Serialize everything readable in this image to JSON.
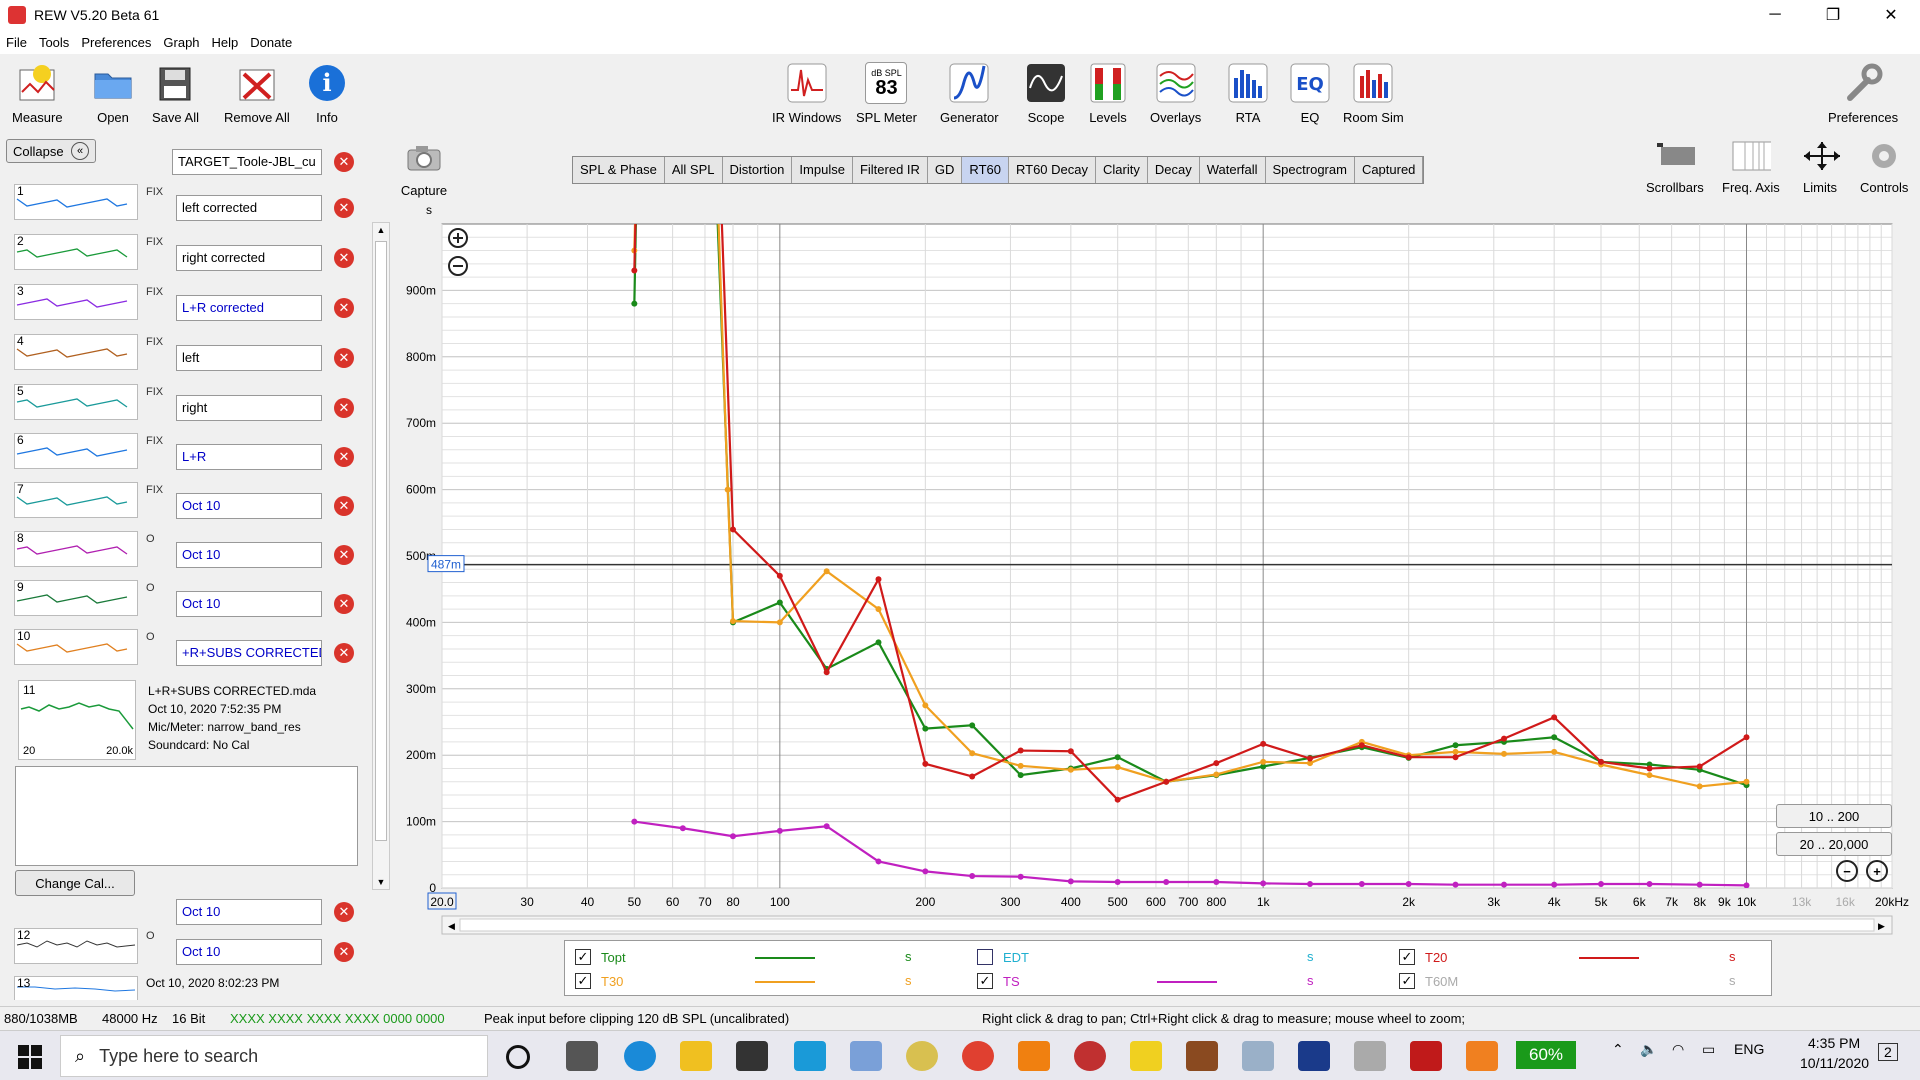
{
  "window": {
    "title": "REW V5.20 Beta 61",
    "minimize": "─",
    "restore": "❐",
    "close": "✕"
  },
  "menu": [
    "File",
    "Tools",
    "Preferences",
    "Graph",
    "Help",
    "Donate"
  ],
  "toolbar": {
    "left": [
      {
        "label": "Measure",
        "icon": "microphone-icon"
      },
      {
        "label": "Open",
        "icon": "folder-icon"
      },
      {
        "label": "Save All",
        "icon": "floppy-icon"
      },
      {
        "label": "Remove All",
        "icon": "remove-all-icon"
      },
      {
        "label": "Info",
        "icon": "info-icon"
      }
    ],
    "center": [
      {
        "label": "IR Windows",
        "icon": "ir-windows-icon"
      },
      {
        "label": "SPL Meter",
        "icon": "spl-meter-icon",
        "meter_unit": "dB SPL",
        "meter_value": "83"
      },
      {
        "label": "Generator",
        "icon": "generator-icon"
      },
      {
        "label": "Scope",
        "icon": "scope-icon"
      },
      {
        "label": "Levels",
        "icon": "levels-icon"
      },
      {
        "label": "Overlays",
        "icon": "overlays-icon"
      },
      {
        "label": "RTA",
        "icon": "rta-icon"
      },
      {
        "label": "EQ",
        "icon": "eq-icon"
      },
      {
        "label": "Room Sim",
        "icon": "room-sim-icon"
      }
    ],
    "preferences": "Preferences"
  },
  "left_panel": {
    "collapse_label": "Collapse",
    "target_name": "TARGET_Toole-JBL_cu",
    "measurements": [
      {
        "num": "1",
        "flag": "FIX",
        "name": "left corrected",
        "blue": false,
        "color": "#1f77e0"
      },
      {
        "num": "2",
        "flag": "FIX",
        "name": "right corrected",
        "blue": false,
        "color": "#1a9a3a"
      },
      {
        "num": "3",
        "flag": "FIX",
        "name": "L+R corrected",
        "blue": true,
        "color": "#8a2be2"
      },
      {
        "num": "4",
        "flag": "FIX",
        "name": "left",
        "blue": false,
        "color": "#b06020"
      },
      {
        "num": "5",
        "flag": "FIX",
        "name": "right",
        "blue": false,
        "color": "#1a9a9a"
      },
      {
        "num": "6",
        "flag": "FIX",
        "name": "L+R",
        "blue": true,
        "color": "#1f77e0"
      },
      {
        "num": "7",
        "flag": "FIX",
        "name": "Oct 10",
        "blue": true,
        "color": "#1a9a9a"
      },
      {
        "num": "8",
        "flag": "O",
        "name": "Oct 10",
        "blue": true,
        "color": "#b020b0"
      },
      {
        "num": "9",
        "flag": "O",
        "name": "Oct 10",
        "blue": true,
        "color": "#1a7a3a"
      },
      {
        "num": "10",
        "flag": "O",
        "name": "+R+SUBS CORRECTED",
        "blue": true,
        "color": "#e08020"
      }
    ],
    "selected_info": {
      "num": "11",
      "file": "L+R+SUBS CORRECTED.mda",
      "date": "Oct 10, 2020 7:52:35 PM",
      "mic": "Mic/Meter: narrow_band_res",
      "soundcard": "Soundcard: No Cal",
      "thumb_min": "20",
      "thumb_max": "20.0k"
    },
    "change_cal": "Change Cal...",
    "more": [
      {
        "num": "",
        "name": "Oct 10"
      },
      {
        "num": "12",
        "name": "Oct 10"
      }
    ],
    "last_date": "Oct 10, 2020 8:02:23 PM",
    "last_num": "13"
  },
  "graph_tabs": [
    "SPL & Phase",
    "All SPL",
    "Distortion",
    "Impulse",
    "Filtered IR",
    "GD",
    "RT60",
    "RT60 Decay",
    "Clarity",
    "Decay",
    "Waterfall",
    "Spectrogram",
    "Captured"
  ],
  "active_tab": "RT60",
  "capture_label": "Capture",
  "right_tools": [
    "Scrollbars",
    "Freq. Axis",
    "Limits",
    "Controls"
  ],
  "range_buttons": [
    "10 .. 200",
    "20 .. 20,000"
  ],
  "chart_data": {
    "type": "line",
    "ylabel": "s",
    "y_ticks": [
      "0",
      "100m",
      "200m",
      "300m",
      "400m",
      "500m",
      "600m",
      "700m",
      "800m",
      "900m"
    ],
    "ylim": [
      0,
      1.0
    ],
    "x_ticks": [
      "20.0",
      "30",
      "40",
      "50",
      "60",
      "70",
      "80",
      "100",
      "200",
      "300",
      "400",
      "500",
      "600",
      "700",
      "800",
      "1k",
      "2k",
      "3k",
      "4k",
      "5k",
      "6k",
      "7k",
      "8k",
      "9k",
      "10k",
      "13k",
      "16k",
      "20kHz"
    ],
    "x_tick_values": [
      20,
      30,
      40,
      50,
      60,
      70,
      80,
      100,
      200,
      300,
      400,
      500,
      600,
      700,
      800,
      1000,
      2000,
      3000,
      4000,
      5000,
      6000,
      7000,
      8000,
      9000,
      10000,
      13000,
      16000,
      20000
    ],
    "xlim": [
      20,
      20000
    ],
    "cursor_label": "487m",
    "cursor_value": 0.487,
    "x_scale": "log",
    "grid": true,
    "series": [
      {
        "name": "Topt",
        "color": "#1a8a1a",
        "x": [
          50,
          51,
          53,
          60,
          70,
          80,
          100,
          125,
          160,
          200,
          250,
          315,
          400,
          500,
          630,
          800,
          1000,
          1250,
          1600,
          2000,
          2500,
          3150,
          4000,
          5000,
          6300,
          8000,
          10000
        ],
        "y": [
          0.88,
          1.2,
          2.0,
          2.4,
          1.5,
          0.4,
          0.43,
          0.33,
          0.37,
          0.24,
          0.245,
          0.17,
          0.18,
          0.197,
          0.16,
          0.17,
          0.183,
          0.196,
          0.212,
          0.196,
          0.215,
          0.22,
          0.227,
          0.19,
          0.186,
          0.178,
          0.155
        ]
      },
      {
        "name": "T30",
        "color": "#f0a020",
        "x": [
          50,
          51,
          53,
          60,
          70,
          78,
          80,
          100,
          125,
          160,
          200,
          250,
          315,
          400,
          500,
          630,
          800,
          1000,
          1250,
          1600,
          2000,
          2500,
          3150,
          4000,
          5000,
          6300,
          8000,
          10000
        ],
        "y": [
          0.96,
          1.2,
          2.0,
          2.4,
          1.6,
          0.6,
          0.402,
          0.4,
          0.477,
          0.42,
          0.275,
          0.203,
          0.184,
          0.178,
          0.182,
          0.16,
          0.171,
          0.19,
          0.188,
          0.22,
          0.2,
          0.205,
          0.202,
          0.205,
          0.186,
          0.17,
          0.153,
          0.16
        ]
      },
      {
        "name": "T20",
        "color": "#d01a1a",
        "x": [
          50,
          51,
          53,
          60,
          70,
          80,
          100,
          125,
          160,
          200,
          250,
          315,
          400,
          500,
          630,
          800,
          1000,
          1250,
          1600,
          2000,
          2500,
          3150,
          4000,
          5000,
          6300,
          8000,
          10000
        ],
        "y": [
          0.93,
          1.2,
          2.0,
          2.4,
          1.7,
          0.54,
          0.47,
          0.325,
          0.465,
          0.187,
          0.168,
          0.207,
          0.206,
          0.133,
          0.16,
          0.188,
          0.217,
          0.195,
          0.215,
          0.197,
          0.197,
          0.225,
          0.257,
          0.19,
          0.18,
          0.183,
          0.227
        ]
      },
      {
        "name": "TS",
        "color": "#c020c0",
        "x": [
          50,
          63,
          80,
          100,
          125,
          160,
          200,
          250,
          315,
          400,
          500,
          630,
          800,
          1000,
          1250,
          1600,
          2000,
          2500,
          3150,
          4000,
          5000,
          6300,
          8000,
          10000
        ],
        "y": [
          0.1,
          0.09,
          0.078,
          0.086,
          0.093,
          0.04,
          0.025,
          0.018,
          0.017,
          0.01,
          0.009,
          0.009,
          0.009,
          0.007,
          0.006,
          0.006,
          0.006,
          0.005,
          0.005,
          0.005,
          0.006,
          0.006,
          0.005,
          0.004
        ]
      }
    ]
  },
  "legend": [
    {
      "label": "Topt",
      "checked": true,
      "color": "#1a8a1a",
      "unit": "s"
    },
    {
      "label": "T30",
      "checked": true,
      "color": "#f0a020",
      "unit": "s"
    },
    {
      "label": "EDT",
      "checked": false,
      "color": "#20b0d0",
      "unit": "s"
    },
    {
      "label": "TS",
      "checked": true,
      "color": "#c020c0",
      "unit": "s"
    },
    {
      "label": "T20",
      "checked": true,
      "color": "#d01a1a",
      "unit": "s"
    },
    {
      "label": "T60M",
      "checked": true,
      "color": "#aaaaaa",
      "unit": "s"
    }
  ],
  "status": {
    "memory": "880/1038MB",
    "rate": "48000 Hz",
    "bits": "16 Bit",
    "meters": "XXXX XXXX   XXXX XXXX   0000 0000",
    "peak": "Peak input before clipping 120 dB SPL (uncalibrated)",
    "hint": "Right click & drag to pan; Ctrl+Right click & drag to measure; mouse wheel to zoom;"
  },
  "taskbar": {
    "search_placeholder": "Type here to search",
    "battery": "60%",
    "lang": "ENG",
    "time": "4:35 PM",
    "date": "10/11/2020",
    "notifications": "2"
  }
}
